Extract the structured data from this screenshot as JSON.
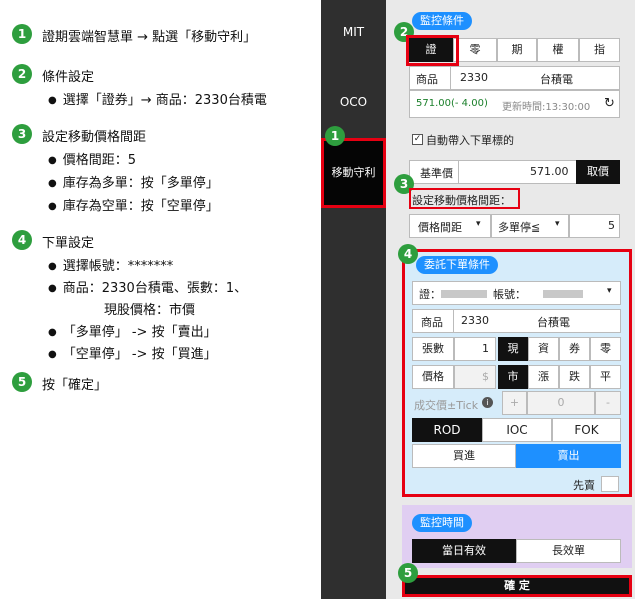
{
  "steps": [
    {
      "num": "1",
      "title": "證期雲端智慧單 → 點選「移動守利」"
    },
    {
      "num": "2",
      "title": "條件設定",
      "subs": [
        "選擇「證券」→ 商品：2330台積電"
      ]
    },
    {
      "num": "3",
      "title": "設定移動價格間距",
      "subs": [
        "價格間距：5",
        "庫存為多單：按「多單停」",
        "庫存為空單：按「空單停」"
      ]
    },
    {
      "num": "4",
      "title": "下單設定",
      "subs": [
        "選擇帳號：*******",
        "商品：2330台積電、張數：1、",
        "現股價格：市價",
        "「多單停」 -> 按「賣出」",
        "「空單停」 -> 按「買進」"
      ]
    },
    {
      "num": "5",
      "title": "按「確定」"
    }
  ],
  "sidebar": {
    "items": [
      "MIT",
      "OCO",
      "移動守利"
    ]
  },
  "monitor": {
    "title": "監控條件",
    "tabs": [
      "證",
      "零",
      "期",
      "權",
      "指"
    ],
    "product_label": "商品",
    "product_code": "2330",
    "product_name": "台積電",
    "price_change": "571.00(- 4.00)",
    "update_time": "更新時間:13:30:00",
    "auto_bring": "自動帶入下單標的",
    "base_label": "基準價",
    "base_value": "571.00",
    "base_btn": "取價",
    "spread_title": "設定移動價格間距：",
    "spread_select": "價格間距",
    "stop_select": "多單停≦",
    "spread_value": "5"
  },
  "order": {
    "title": "委託下單條件",
    "account_prefix": "證：",
    "account_label": "帳號：",
    "product_label": "商品",
    "product_code": "2330",
    "product_name": "台積電",
    "qty_label": "張數",
    "qty_value": "1",
    "qty_types": [
      "現",
      "資",
      "券",
      "零"
    ],
    "price_label": "價格",
    "price_placeholder": "$",
    "price_types": [
      "市",
      "漲",
      "跌",
      "平"
    ],
    "tick_label": "成交價±Tick",
    "tick_plus": "+",
    "tick_value": "0",
    "tick_minus": "-",
    "tif": [
      "ROD",
      "IOC",
      "FOK"
    ],
    "buy": "買進",
    "sell": "賣出",
    "first_sell": "先賣"
  },
  "time": {
    "title": "監控時間",
    "options": [
      "當日有效",
      "長效單"
    ]
  },
  "confirm": "確 定",
  "markers": [
    "1",
    "2",
    "3",
    "4",
    "5"
  ]
}
